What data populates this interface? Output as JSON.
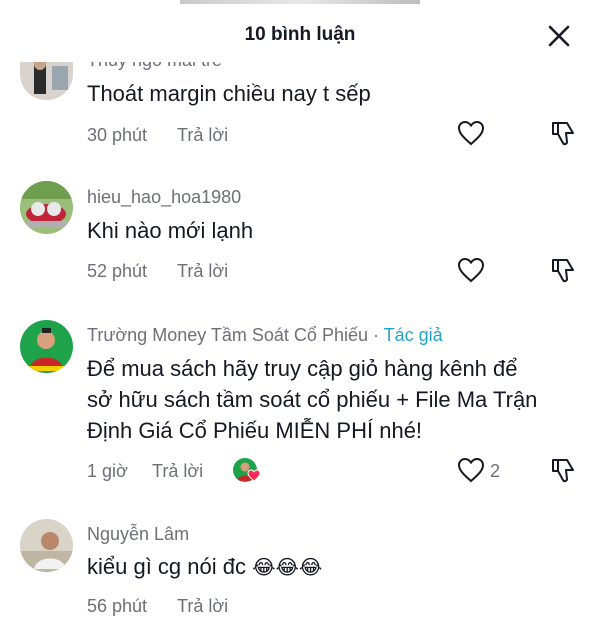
{
  "header": {
    "title": "10 bình luận",
    "close_icon": "close-icon"
  },
  "colors": {
    "author_accent": "#20a4c9",
    "muted": "#6e7077",
    "text": "#161823",
    "heart_red": "#fe2c55"
  },
  "comments": [
    {
      "username": "Thuy ngo mai tre",
      "text": "Thoát margin chiều nay t sếp",
      "time": "30 phút",
      "reply": "Trả lời"
    },
    {
      "username": "hieu_hao_hoa1980",
      "text": "Khi nào mới lạnh",
      "time": "52 phút",
      "reply": "Trả lời"
    },
    {
      "username": "Trường Money Tầm Soát Cổ Phiếu",
      "author_sep": " · ",
      "author_tag": "Tác giả",
      "text_lines": [
        "Để mua sách hãy truy cập giỏ hàng kênh để",
        "sở hữu sách tầm soát cổ phiếu + File Ma Trận",
        "Định Giá Cổ Phiếu MIỄN PHÍ nhé!"
      ],
      "time": "1 giờ",
      "reply": "Trả lời",
      "like_count": "2"
    },
    {
      "username": "Nguyễn Lâm",
      "text": "kiểu gì cg nói đc",
      "emojis": "😂😂😂",
      "time": "56 phút",
      "reply": "Trả lời"
    }
  ]
}
